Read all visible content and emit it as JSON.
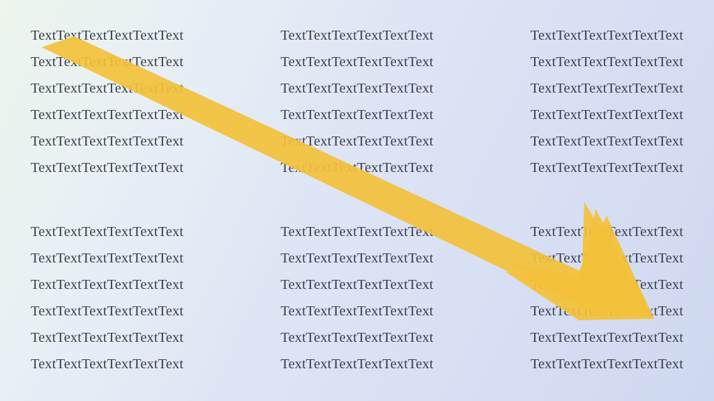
{
  "repeated_word": "Text",
  "columns": 3,
  "blocks": 2,
  "rows_per_block": 6,
  "word_repeat_per_cell": 6,
  "cell_sample": "TextTextTextTextTextText",
  "arrow": {
    "direction": "diagonal-down-right",
    "color": "#f3c13a",
    "opacity": 0.92
  }
}
